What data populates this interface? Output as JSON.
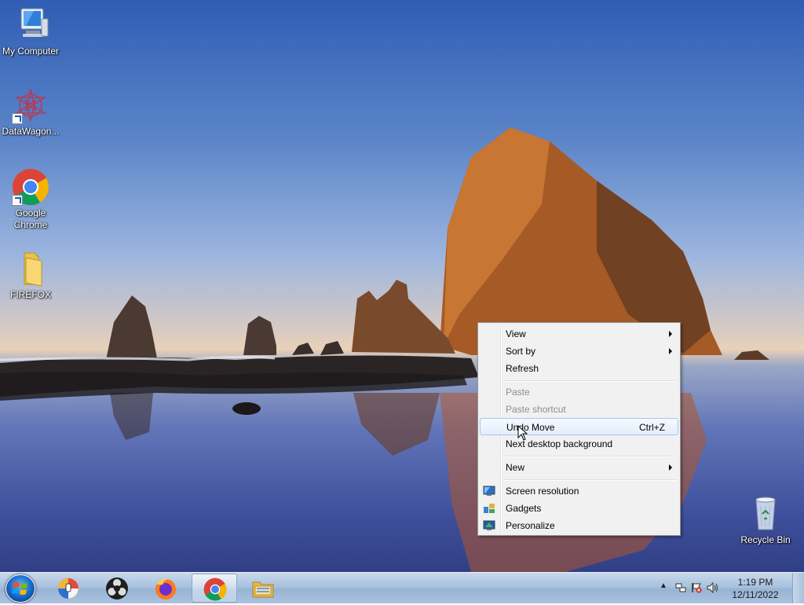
{
  "desktop": {
    "icons": [
      {
        "label": "My Computer",
        "icon": "computer-icon"
      },
      {
        "label": "DataWagon...",
        "icon": "datawagon-icon"
      },
      {
        "label": "Google Chrome",
        "icon": "chrome-icon"
      },
      {
        "label": "FIREFOX",
        "icon": "folder-icon"
      },
      {
        "label": "Recycle Bin",
        "icon": "recycle-bin-icon"
      }
    ]
  },
  "context_menu": {
    "items": [
      {
        "label": "View",
        "submenu": true
      },
      {
        "label": "Sort by",
        "submenu": true
      },
      {
        "label": "Refresh"
      },
      {
        "label": "Paste",
        "disabled": true
      },
      {
        "label": "Paste shortcut",
        "disabled": true
      },
      {
        "label": "Undo Move",
        "shortcut": "Ctrl+Z",
        "hovered": true
      },
      {
        "label": "Next desktop background"
      },
      {
        "label": "New",
        "submenu": true
      },
      {
        "label": "Screen resolution",
        "icon": "screen-resolution-icon"
      },
      {
        "label": "Gadgets",
        "icon": "gadgets-icon"
      },
      {
        "label": "Personalize",
        "icon": "personalize-icon"
      }
    ]
  },
  "taskbar": {
    "pinned": [
      "proxy-app-icon",
      "obs-icon",
      "firefox-icon",
      "chrome-icon",
      "file-explorer-icon"
    ],
    "active": "chrome-icon",
    "tray": {
      "icons": [
        "show-hidden-icons-icon",
        "network-icon",
        "action-center-flag-icon",
        "volume-icon"
      ],
      "time": "1:19 PM",
      "date": "12/11/2022"
    }
  }
}
